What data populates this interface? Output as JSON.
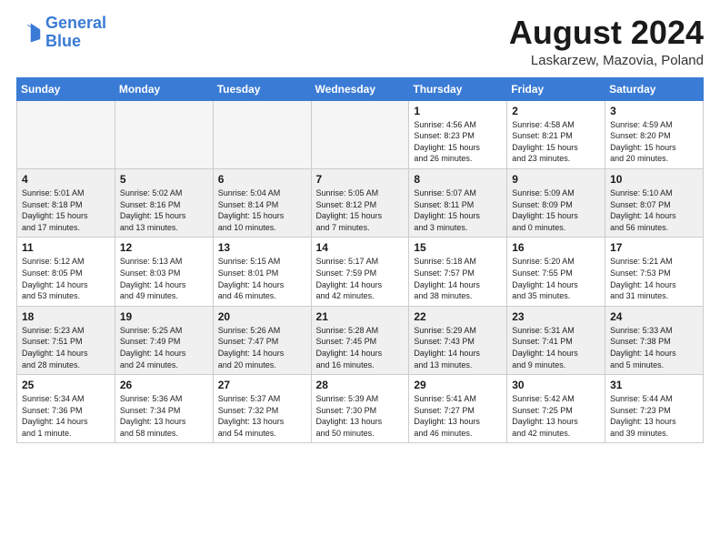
{
  "logo": {
    "line1": "General",
    "line2": "Blue"
  },
  "title": "August 2024",
  "location": "Laskarzew, Mazovia, Poland",
  "days_of_week": [
    "Sunday",
    "Monday",
    "Tuesday",
    "Wednesday",
    "Thursday",
    "Friday",
    "Saturday"
  ],
  "weeks": [
    [
      {
        "day": "",
        "info": ""
      },
      {
        "day": "",
        "info": ""
      },
      {
        "day": "",
        "info": ""
      },
      {
        "day": "",
        "info": ""
      },
      {
        "day": "1",
        "info": "Sunrise: 4:56 AM\nSunset: 8:23 PM\nDaylight: 15 hours\nand 26 minutes."
      },
      {
        "day": "2",
        "info": "Sunrise: 4:58 AM\nSunset: 8:21 PM\nDaylight: 15 hours\nand 23 minutes."
      },
      {
        "day": "3",
        "info": "Sunrise: 4:59 AM\nSunset: 8:20 PM\nDaylight: 15 hours\nand 20 minutes."
      }
    ],
    [
      {
        "day": "4",
        "info": "Sunrise: 5:01 AM\nSunset: 8:18 PM\nDaylight: 15 hours\nand 17 minutes."
      },
      {
        "day": "5",
        "info": "Sunrise: 5:02 AM\nSunset: 8:16 PM\nDaylight: 15 hours\nand 13 minutes."
      },
      {
        "day": "6",
        "info": "Sunrise: 5:04 AM\nSunset: 8:14 PM\nDaylight: 15 hours\nand 10 minutes."
      },
      {
        "day": "7",
        "info": "Sunrise: 5:05 AM\nSunset: 8:12 PM\nDaylight: 15 hours\nand 7 minutes."
      },
      {
        "day": "8",
        "info": "Sunrise: 5:07 AM\nSunset: 8:11 PM\nDaylight: 15 hours\nand 3 minutes."
      },
      {
        "day": "9",
        "info": "Sunrise: 5:09 AM\nSunset: 8:09 PM\nDaylight: 15 hours\nand 0 minutes."
      },
      {
        "day": "10",
        "info": "Sunrise: 5:10 AM\nSunset: 8:07 PM\nDaylight: 14 hours\nand 56 minutes."
      }
    ],
    [
      {
        "day": "11",
        "info": "Sunrise: 5:12 AM\nSunset: 8:05 PM\nDaylight: 14 hours\nand 53 minutes."
      },
      {
        "day": "12",
        "info": "Sunrise: 5:13 AM\nSunset: 8:03 PM\nDaylight: 14 hours\nand 49 minutes."
      },
      {
        "day": "13",
        "info": "Sunrise: 5:15 AM\nSunset: 8:01 PM\nDaylight: 14 hours\nand 46 minutes."
      },
      {
        "day": "14",
        "info": "Sunrise: 5:17 AM\nSunset: 7:59 PM\nDaylight: 14 hours\nand 42 minutes."
      },
      {
        "day": "15",
        "info": "Sunrise: 5:18 AM\nSunset: 7:57 PM\nDaylight: 14 hours\nand 38 minutes."
      },
      {
        "day": "16",
        "info": "Sunrise: 5:20 AM\nSunset: 7:55 PM\nDaylight: 14 hours\nand 35 minutes."
      },
      {
        "day": "17",
        "info": "Sunrise: 5:21 AM\nSunset: 7:53 PM\nDaylight: 14 hours\nand 31 minutes."
      }
    ],
    [
      {
        "day": "18",
        "info": "Sunrise: 5:23 AM\nSunset: 7:51 PM\nDaylight: 14 hours\nand 28 minutes."
      },
      {
        "day": "19",
        "info": "Sunrise: 5:25 AM\nSunset: 7:49 PM\nDaylight: 14 hours\nand 24 minutes."
      },
      {
        "day": "20",
        "info": "Sunrise: 5:26 AM\nSunset: 7:47 PM\nDaylight: 14 hours\nand 20 minutes."
      },
      {
        "day": "21",
        "info": "Sunrise: 5:28 AM\nSunset: 7:45 PM\nDaylight: 14 hours\nand 16 minutes."
      },
      {
        "day": "22",
        "info": "Sunrise: 5:29 AM\nSunset: 7:43 PM\nDaylight: 14 hours\nand 13 minutes."
      },
      {
        "day": "23",
        "info": "Sunrise: 5:31 AM\nSunset: 7:41 PM\nDaylight: 14 hours\nand 9 minutes."
      },
      {
        "day": "24",
        "info": "Sunrise: 5:33 AM\nSunset: 7:38 PM\nDaylight: 14 hours\nand 5 minutes."
      }
    ],
    [
      {
        "day": "25",
        "info": "Sunrise: 5:34 AM\nSunset: 7:36 PM\nDaylight: 14 hours\nand 1 minute."
      },
      {
        "day": "26",
        "info": "Sunrise: 5:36 AM\nSunset: 7:34 PM\nDaylight: 13 hours\nand 58 minutes."
      },
      {
        "day": "27",
        "info": "Sunrise: 5:37 AM\nSunset: 7:32 PM\nDaylight: 13 hours\nand 54 minutes."
      },
      {
        "day": "28",
        "info": "Sunrise: 5:39 AM\nSunset: 7:30 PM\nDaylight: 13 hours\nand 50 minutes."
      },
      {
        "day": "29",
        "info": "Sunrise: 5:41 AM\nSunset: 7:27 PM\nDaylight: 13 hours\nand 46 minutes."
      },
      {
        "day": "30",
        "info": "Sunrise: 5:42 AM\nSunset: 7:25 PM\nDaylight: 13 hours\nand 42 minutes."
      },
      {
        "day": "31",
        "info": "Sunrise: 5:44 AM\nSunset: 7:23 PM\nDaylight: 13 hours\nand 39 minutes."
      }
    ]
  ]
}
